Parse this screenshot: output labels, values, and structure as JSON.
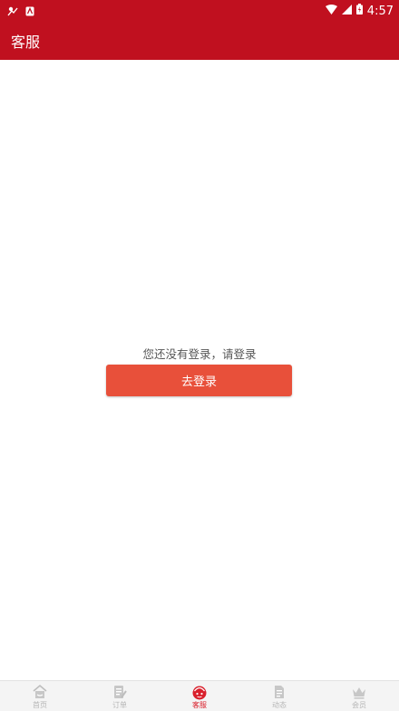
{
  "status_bar": {
    "time": "4:57",
    "left_icons": [
      "notification-app-icon",
      "sim-card-icon"
    ],
    "right_icons": [
      "wifi-icon",
      "signal-icon",
      "battery-icon"
    ]
  },
  "header": {
    "title": "客服",
    "background_color": "#c0101f"
  },
  "main": {
    "prompt_text": "您还没有登录，请登录",
    "login_button_label": "去登录",
    "button_color": "#e8503a"
  },
  "bottom_nav": {
    "active_color": "#d9202c",
    "items": [
      {
        "label": "首页",
        "icon": "home-icon",
        "active": false
      },
      {
        "label": "订单",
        "icon": "order-icon",
        "active": false
      },
      {
        "label": "客服",
        "icon": "service-icon",
        "active": true
      },
      {
        "label": "动态",
        "icon": "news-icon",
        "active": false
      },
      {
        "label": "会员",
        "icon": "crown-icon",
        "active": false
      }
    ]
  }
}
